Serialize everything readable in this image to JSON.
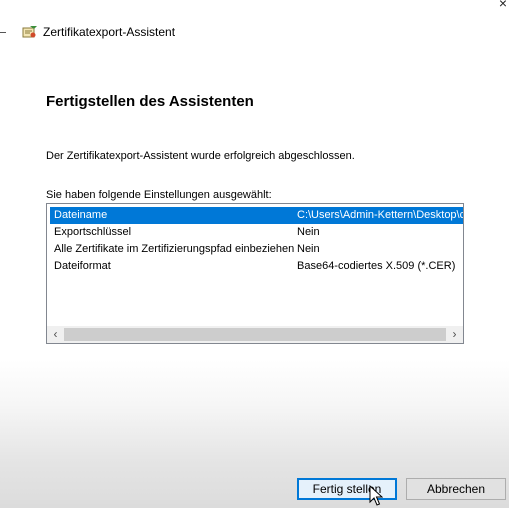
{
  "window": {
    "title": "Zertifikatexport-Assistent",
    "close_glyph": "×"
  },
  "icons": {
    "title_icon": "certificate-wizard-icon",
    "close_icon": "close-icon",
    "scroll_left_icon": "chevron-left-icon",
    "scroll_right_icon": "chevron-right-icon",
    "cursor_icon": "mouse-pointer-icon"
  },
  "page": {
    "heading": "Fertigstellen des Assistenten",
    "success_message": "Der Zertifikatexport-Assistent wurde erfolgreich abgeschlossen.",
    "settings_caption": "Sie haben folgende Einstellungen ausgewählt:"
  },
  "settings_list": {
    "selected_index": 0,
    "rows": [
      {
        "name": "Dateiname",
        "value": "C:\\Users\\Admin-Kettern\\Desktop\\c"
      },
      {
        "name": "Exportschlüssel",
        "value": "Nein"
      },
      {
        "name": "Alle Zertifikate im Zertifizierungspfad einbeziehen",
        "value": "Nein"
      },
      {
        "name": "Dateiformat",
        "value": "Base64-codiertes X.509 (*.CER)"
      }
    ],
    "scroll_left_glyph": "‹",
    "scroll_right_glyph": "›"
  },
  "buttons": {
    "finish_label": "Fertig stellen",
    "cancel_label": "Abbrechen"
  },
  "colors": {
    "selection_accent": "#0078d7",
    "default_button_border": "#0078d7"
  }
}
